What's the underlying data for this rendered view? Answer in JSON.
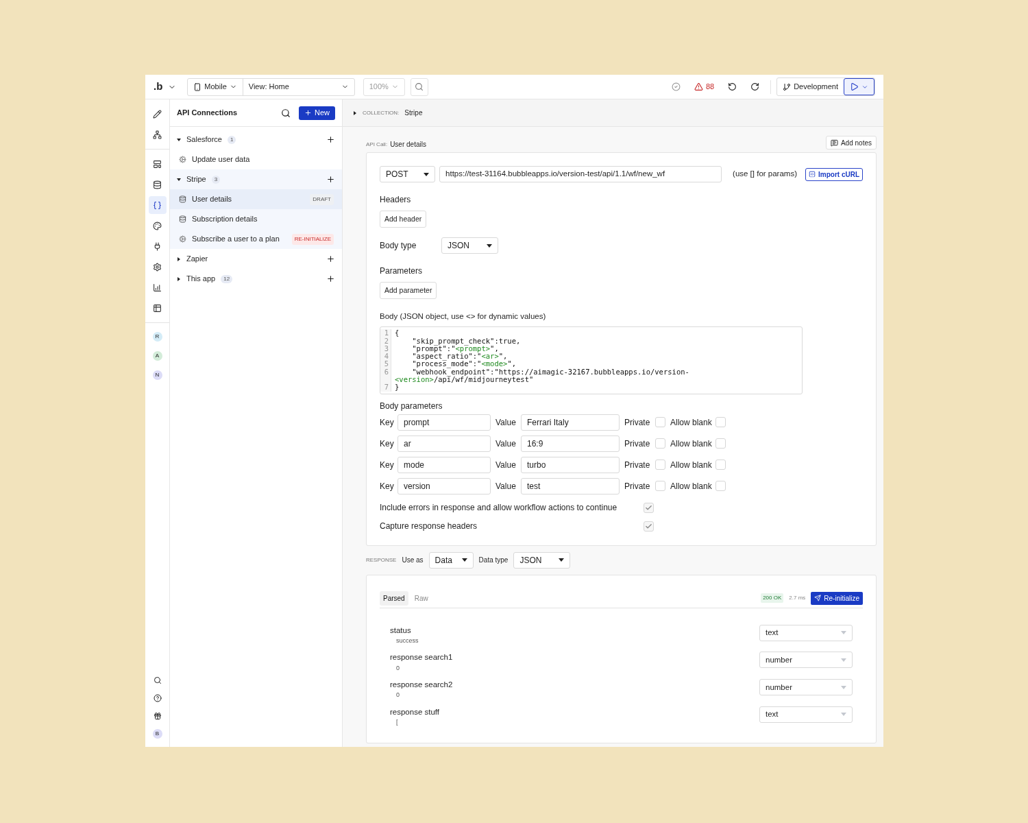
{
  "topbar": {
    "logo": ".b",
    "device": "Mobile",
    "view": "View: Home",
    "zoom": "100%",
    "issues": "88",
    "branch": "Development"
  },
  "rail": [
    {
      "kind": "icon",
      "selected": false
    },
    {
      "kind": "icon",
      "selected": false
    },
    {
      "kind": "divider"
    },
    {
      "kind": "icon",
      "selected": false
    },
    {
      "kind": "icon",
      "selected": false
    },
    {
      "kind": "icon",
      "selected": true
    },
    {
      "kind": "icon",
      "selected": false
    },
    {
      "kind": "icon",
      "selected": false
    },
    {
      "kind": "icon",
      "selected": false
    },
    {
      "kind": "icon",
      "selected": false
    },
    {
      "kind": "icon",
      "selected": false
    },
    {
      "kind": "divider"
    },
    {
      "kind": "avatar",
      "label": "R",
      "color": "#d4ecf7"
    },
    {
      "kind": "avatar",
      "label": "A",
      "color": "#d3ecd9"
    },
    {
      "kind": "avatar",
      "label": "N",
      "color": "#dcdcf7"
    }
  ],
  "rail_bottom": [
    {
      "kind": "icon"
    },
    {
      "kind": "icon"
    },
    {
      "kind": "icon"
    },
    {
      "kind": "avatar",
      "label": "B",
      "color": "#dcdcf7"
    }
  ],
  "sidebar": {
    "title": "API Connections",
    "new_button": "New",
    "groups": [
      {
        "name": "Salesforce",
        "count": "1",
        "expanded": true,
        "children": [
          {
            "label": "Update user data",
            "kind": "action",
            "selected": false
          }
        ]
      },
      {
        "name": "Stripe",
        "count": "3",
        "expanded": true,
        "children": [
          {
            "label": "User details",
            "kind": "data",
            "selected": true,
            "badge": {
              "text": "DRAFT",
              "kind": "draft"
            }
          },
          {
            "label": "Subscription details",
            "kind": "data",
            "selected": false
          },
          {
            "label": "Subscribe a user to a plan",
            "kind": "action",
            "selected": false,
            "badge": {
              "text": "RE-INITIALIZE",
              "kind": "warning"
            }
          }
        ]
      },
      {
        "name": "Zapier",
        "expanded": false
      },
      {
        "name": "This app",
        "count": "12",
        "expanded": false
      }
    ]
  },
  "breadcrumb": {
    "label": "COLLECTION:",
    "value": "Stripe"
  },
  "call": {
    "label": "API Call:",
    "name": "User details",
    "notes_button": "Add notes",
    "method": "POST",
    "url": "https://test-31164.bubbleapps.io/version-test/api/1.1/wf/new_wf",
    "url_hint": "(use [] for params)",
    "import_button": "Import cURL",
    "headers_label": "Headers",
    "add_header": "Add header",
    "body_type_label": "Body type",
    "body_type": "JSON",
    "parameters_label": "Parameters",
    "add_parameter": "Add parameter",
    "body_label": "Body (JSON object, use <> for dynamic values)",
    "code_lines": [
      {
        "number": "1",
        "segments": [
          {
            "text": "{",
            "kind": "plain"
          }
        ]
      },
      {
        "number": "2",
        "segments": [
          {
            "text": "    \"skip_prompt_check\":true,",
            "kind": "plain"
          }
        ]
      },
      {
        "number": "3",
        "segments": [
          {
            "text": "    \"prompt\":\"",
            "kind": "plain"
          },
          {
            "text": "<prompt>",
            "kind": "dynamic"
          },
          {
            "text": "\",",
            "kind": "plain"
          }
        ]
      },
      {
        "number": "4",
        "segments": [
          {
            "text": "    \"aspect_ratio\":\"",
            "kind": "plain"
          },
          {
            "text": "<ar>",
            "kind": "dynamic"
          },
          {
            "text": "\",",
            "kind": "plain"
          }
        ]
      },
      {
        "number": "5",
        "segments": [
          {
            "text": "    \"process_mode\":\"",
            "kind": "plain"
          },
          {
            "text": "<mode>",
            "kind": "dynamic"
          },
          {
            "text": "\",",
            "kind": "plain"
          }
        ]
      },
      {
        "number": "6",
        "segments": [
          {
            "text": "    \"webhook_endpoint\":\"https://aimagic-32167.bubbleapps.io/version-",
            "kind": "plain"
          }
        ]
      },
      {
        "segments": [
          {
            "text": "<version>",
            "kind": "dynamic"
          },
          {
            "text": "/api/wf/midjourneytest\"",
            "kind": "plain"
          }
        ]
      },
      {
        "number": "7",
        "segments": [
          {
            "text": "}",
            "kind": "plain"
          }
        ]
      }
    ],
    "body_params_label": "Body parameters",
    "body_params": [
      {
        "key_label": "Key",
        "key": "prompt",
        "value_label": "Value",
        "value": "Ferrari Italy",
        "private_label": "Private",
        "private": false,
        "allow_blank_label": "Allow blank",
        "allow_blank": false
      },
      {
        "key_label": "Key",
        "key": "ar",
        "value_label": "Value",
        "value": "16:9",
        "private_label": "Private",
        "private": false,
        "allow_blank_label": "Allow blank",
        "allow_blank": false
      },
      {
        "key_label": "Key",
        "key": "mode",
        "value_label": "Value",
        "value": "turbo",
        "private_label": "Private",
        "private": false,
        "allow_blank_label": "Allow blank",
        "allow_blank": false
      },
      {
        "key_label": "Key",
        "key": "version",
        "value_label": "Value",
        "value": "test",
        "private_label": "Private",
        "private": false,
        "allow_blank_label": "Allow blank",
        "allow_blank": false
      }
    ],
    "options": [
      {
        "label": "Include errors in response and allow workflow actions to continue",
        "checked": true
      },
      {
        "label": "Capture response headers",
        "checked": true
      }
    ]
  },
  "response": {
    "label": "RESPONSE",
    "use_as_label": "Use as",
    "use_as": "Data",
    "data_type_label": "Data type",
    "data_type": "JSON",
    "tabs": [
      {
        "label": "Parsed",
        "selected": true
      },
      {
        "label": "Raw",
        "selected": false
      }
    ],
    "status": "200 OK",
    "time": "2.7 ms",
    "reinit_button": "Re-initialize",
    "fields": [
      {
        "name": "status",
        "sample": "success",
        "type": "text"
      },
      {
        "name": "response search1",
        "sample": "0",
        "type": "number"
      },
      {
        "name": "response search2",
        "sample": "0",
        "type": "number"
      },
      {
        "name": "response stuff",
        "sample": "[",
        "type": "text"
      }
    ]
  }
}
